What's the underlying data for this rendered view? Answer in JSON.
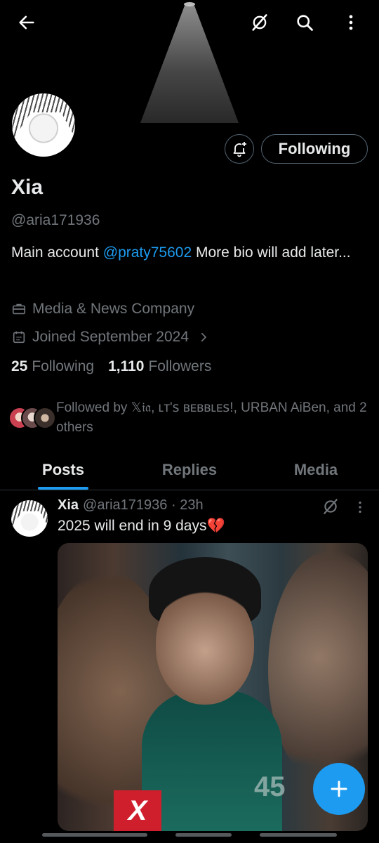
{
  "profile": {
    "name": "Xia",
    "handle": "@aria171936",
    "bio_prefix": "Main account ",
    "bio_mention": "@praty75602",
    "bio_suffix": " More bio will add later...",
    "category": "Media & News Company",
    "joined": "Joined September 2024",
    "following_count": "25",
    "following_label": "Following",
    "followers_count": "1,110",
    "followers_label": "Followers",
    "followed_by": "Followed by 𝕏𝔦𝔞, ʟᴛ'ꜱ ʙᴇʙʙʟᴇꜱ!, URBAN AiBen, and 2 others"
  },
  "actions": {
    "follow_label": "Following"
  },
  "tabs": [
    {
      "label": "Posts",
      "active": true
    },
    {
      "label": "Replies",
      "active": false
    },
    {
      "label": "Media",
      "active": false
    }
  ],
  "tweet": {
    "name": "Xia",
    "meta": "@aria171936 · 23h",
    "text": "2025 will end in 9 days",
    "emoji": "💔",
    "image_badge": "X",
    "image_number": "45"
  },
  "icons": {
    "back": "arrow-left-icon",
    "grok": "grok-icon",
    "search": "search-icon",
    "more": "more-vertical-icon",
    "bell": "bell-plus-icon",
    "briefcase": "briefcase-icon",
    "calendar": "calendar-icon",
    "compose": "plus-icon"
  },
  "colors": {
    "accent": "#1d9bf0",
    "muted": "#71767b",
    "text": "#e7e9ea",
    "background": "#000000"
  }
}
